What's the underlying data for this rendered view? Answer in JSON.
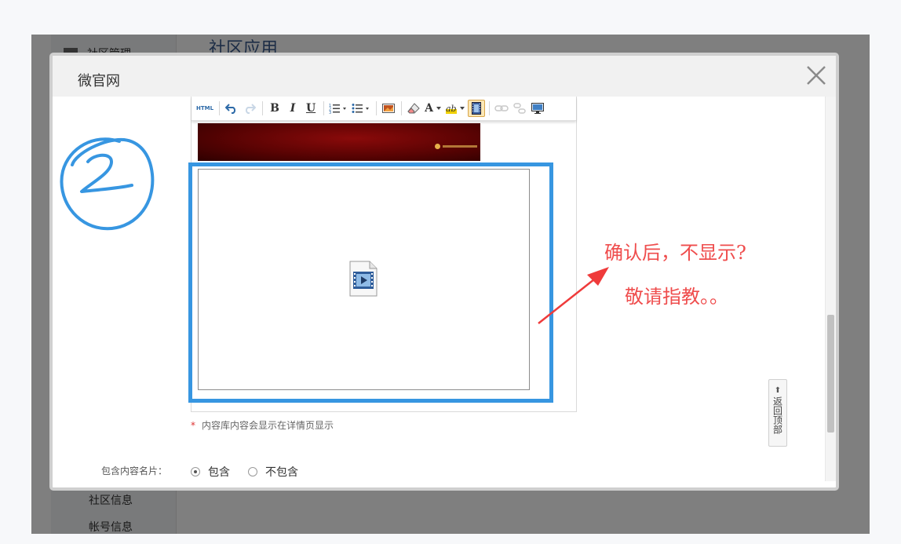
{
  "background": {
    "page_title": "社区应用",
    "sidebar": {
      "header": "社区管理",
      "items": [
        "社区信息",
        "帐号信息"
      ]
    }
  },
  "modal": {
    "title": "微官网",
    "close_icon": "close-icon"
  },
  "editor": {
    "toolbar": {
      "html": "HTML",
      "bold": "B",
      "italic": "I",
      "underline": "U",
      "font_color": "A",
      "highlight": "ab",
      "icons": [
        "html-source-icon",
        "undo-icon",
        "redo-icon",
        "bold-icon",
        "italic-icon",
        "underline-icon",
        "ordered-list-icon",
        "unordered-list-icon",
        "image-icon",
        "eraser-icon",
        "font-color-icon",
        "highlight-icon",
        "video-icon",
        "link-icon",
        "unlink-icon",
        "fullscreen-icon"
      ]
    }
  },
  "hint": {
    "star": "*",
    "text": "内容库内容会显示在详情页显示"
  },
  "back_to_top": "返回顶部",
  "include_card": {
    "label": "包含内容名片：",
    "options": [
      {
        "label": "包含",
        "checked": true
      },
      {
        "label": "不包含",
        "checked": false
      }
    ]
  },
  "annotation": {
    "circle_number": "2",
    "line1": "确认后，不显示?",
    "line2": "敬请指教。。",
    "color_blue": "#3796e1",
    "color_red": "#ef4d4d"
  }
}
